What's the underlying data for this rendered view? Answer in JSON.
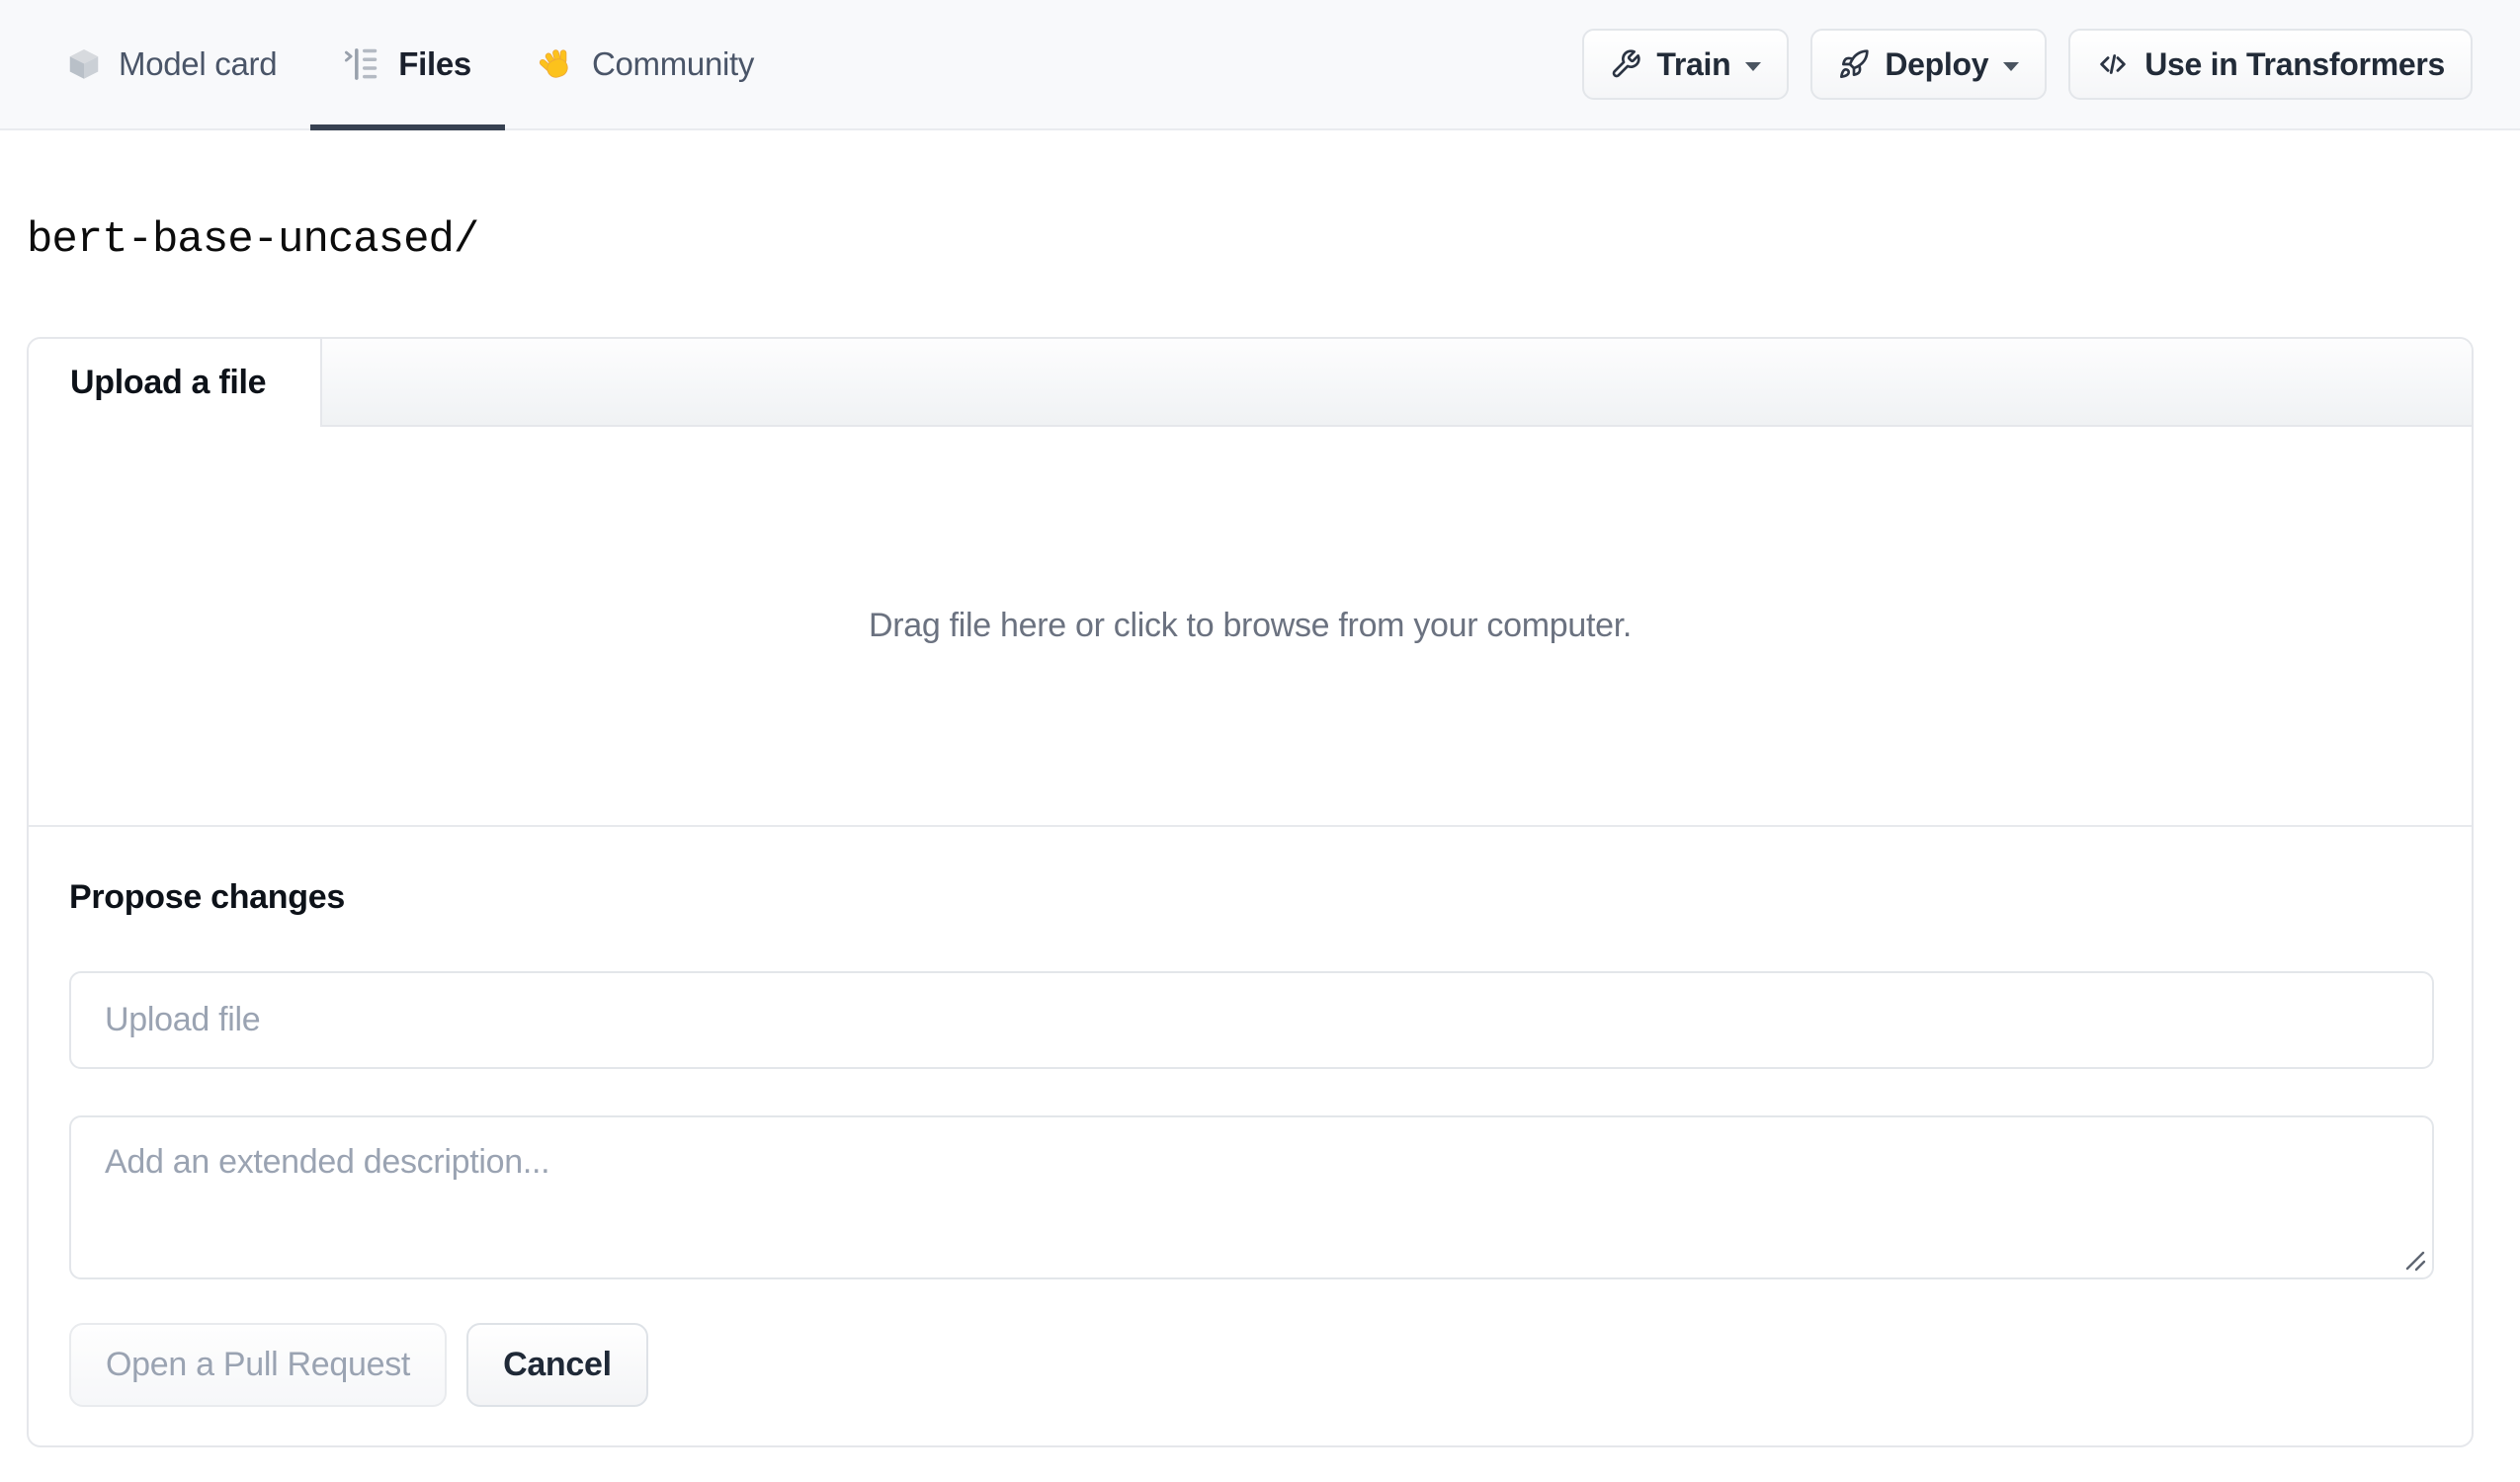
{
  "header": {
    "tabs": [
      {
        "label": "Model card",
        "icon": "cube-icon"
      },
      {
        "label": "Files",
        "icon": "file-versions-icon",
        "active": true
      },
      {
        "label": "Community",
        "icon": "waving-hand-icon"
      }
    ],
    "actions": [
      {
        "label": "Train",
        "icon": "wrench-icon",
        "caret": true
      },
      {
        "label": "Deploy",
        "icon": "rocket-icon",
        "caret": true
      },
      {
        "label": "Use in Transformers",
        "icon": "code-icon",
        "caret": false
      }
    ]
  },
  "path_title": "bert-base-uncased/",
  "upload_card": {
    "tab_label": "Upload a file",
    "dropzone_text": "Drag file here or click to browse from your computer."
  },
  "propose_changes": {
    "heading": "Propose changes",
    "file_input_placeholder": "Upload file",
    "description_placeholder": "Add an extended description...",
    "open_pr_label": "Open a Pull Request",
    "cancel_label": "Cancel"
  },
  "colors": {
    "header_bg": "#f8f9fb",
    "active_tab_underline": "#374151",
    "card_border": "#e5e7eb",
    "muted_text": "#6b7280",
    "placeholder_text": "#9aa3b2",
    "dark_text": "#111827",
    "hand_emoji": "#fcc21c"
  }
}
